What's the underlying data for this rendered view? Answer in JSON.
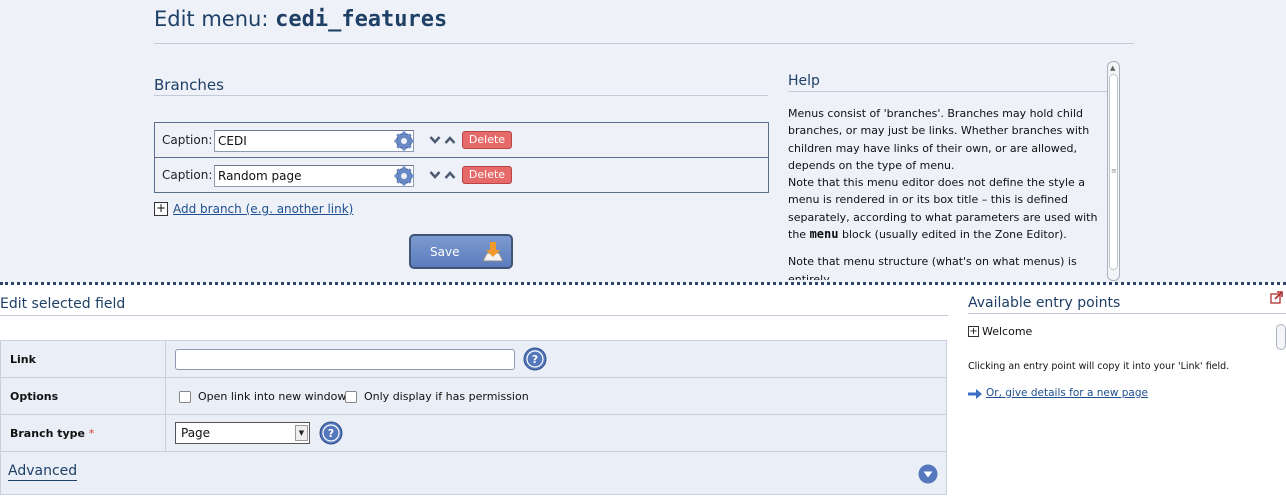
{
  "page": {
    "title_prefix": "Edit menu: ",
    "title_menu_code": "cedi_features"
  },
  "branches": {
    "heading": "Branches",
    "rows": [
      {
        "caption_label": "Caption:",
        "caption_value": "CEDI",
        "delete_label": "Delete"
      },
      {
        "caption_label": "Caption:",
        "caption_value": "Random page",
        "delete_label": "Delete"
      }
    ],
    "add_branch_label": "Add branch (e.g. another link)",
    "save_label": "Save"
  },
  "help": {
    "heading": "Help",
    "para1": "Menus consist of 'branches'. Branches may hold child branches, or may just be links. Whether branches with children may have links of their own, or are allowed, depends on the type of menu.",
    "para2_before": "Note that this menu editor does not define the style a menu is rendered in or its box title – this is defined separately, according to what parameters are used with the ",
    "para2_code": "menu",
    "para2_after": " block (usually edited in the Zone Editor).",
    "para3": "Note that menu structure (what's on what menus) is entirely"
  },
  "edit_field": {
    "heading": "Edit selected field",
    "link_label": "Link",
    "link_value": "",
    "options_label": "Options",
    "option_new_window": "Open link into new window",
    "option_permission": "Only display if has permission",
    "branch_type_label": "Branch type",
    "required_marker": "*",
    "branch_type_value": "Page",
    "advanced_label": "Advanced"
  },
  "entry_points": {
    "heading": "Available entry points",
    "items": [
      "Welcome"
    ],
    "note": "Clicking an entry point will copy it into your 'Link' field.",
    "new_page_link": "Or, give details for a new page"
  },
  "colors": {
    "accent": "#1e3f66",
    "delete": "#e66a6a",
    "save": "#6a8ac6",
    "panel_bg": "#eef1f8"
  },
  "icons": [
    "gear-icon",
    "arrow-down-icon",
    "arrow-up-icon",
    "plus-icon",
    "save-icon",
    "help-icon",
    "expand-icon",
    "popout-icon",
    "arrow-right-icon"
  ]
}
